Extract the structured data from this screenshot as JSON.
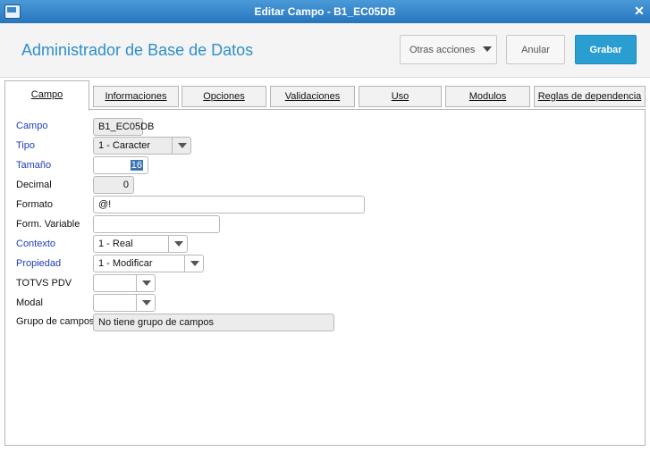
{
  "window": {
    "title": "Editar Campo - B1_EC05DB",
    "close_glyph": "✕"
  },
  "header": {
    "app_title": "Administrador de Base de Datos",
    "actions": {
      "otras": "Otras acciones",
      "anular": "Anular",
      "grabar": "Grabar"
    }
  },
  "tabs": [
    "Campo",
    "Informaciones",
    "Opciones",
    "Validaciones",
    "Uso",
    "Modulos",
    "Reglas de dependencia"
  ],
  "form": {
    "campo": {
      "label": "Campo",
      "value": "B1_EC05DB"
    },
    "tipo": {
      "label": "Tipo",
      "value": "1 - Caracter"
    },
    "tamano": {
      "label": "Tamaño",
      "value": "16"
    },
    "decimal": {
      "label": "Decimal",
      "value": "0"
    },
    "formato": {
      "label": "Formato",
      "value": "@!"
    },
    "form_variable": {
      "label": "Form. Variable",
      "value": ""
    },
    "contexto": {
      "label": "Contexto",
      "value": "1 - Real"
    },
    "propiedad": {
      "label": "Propiedad",
      "value": "1 - Modificar"
    },
    "totvs_pdv": {
      "label": "TOTVS PDV",
      "value": ""
    },
    "modal": {
      "label": "Modal",
      "value": ""
    },
    "grupo_campos": {
      "label": "Grupo de campos",
      "value": "No tiene grupo de campos"
    }
  }
}
